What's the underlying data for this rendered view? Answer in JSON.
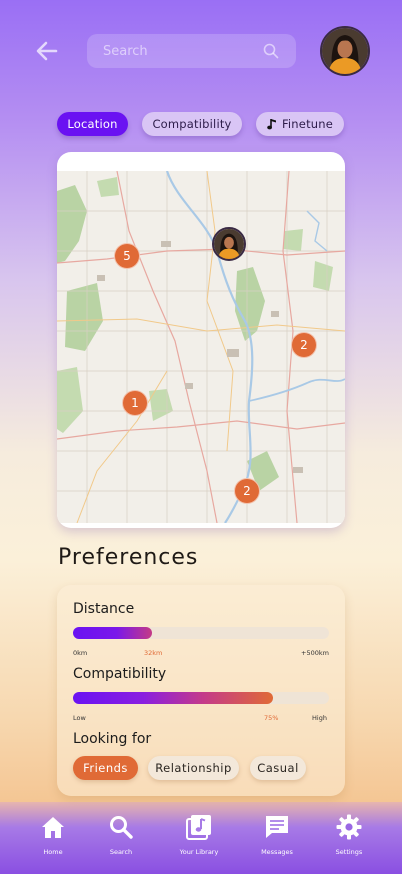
{
  "header": {
    "search_placeholder": "Search",
    "back_icon": "arrow-left-icon",
    "avatar_icon": "profile-avatar"
  },
  "tabs": [
    {
      "label": "Location",
      "active": true
    },
    {
      "label": "Compatibility",
      "active": false
    },
    {
      "label": "Finetune",
      "active": false,
      "icon": "music-note-icon"
    }
  ],
  "map": {
    "clusters": [
      {
        "count": "5"
      },
      {
        "count": "2"
      },
      {
        "count": "1"
      },
      {
        "count": "2"
      }
    ]
  },
  "preferences": {
    "title": "Preferences",
    "distance": {
      "label": "Distance",
      "value_fraction": 0.31,
      "min_label": "0km",
      "value_label": "32km",
      "max_label": "+500km"
    },
    "compatibility": {
      "label": "Compatibility",
      "value_fraction": 0.78,
      "min_label": "Low",
      "value_label": "75%",
      "max_label": "High"
    },
    "looking_for": {
      "label": "Looking for",
      "options": [
        {
          "label": "Friends",
          "selected": true
        },
        {
          "label": "Relationship",
          "selected": false
        },
        {
          "label": "Casual",
          "selected": false
        }
      ]
    }
  },
  "nav": [
    {
      "label": "Home",
      "icon": "home-icon"
    },
    {
      "label": "Search",
      "icon": "search-icon"
    },
    {
      "label": "Your Library",
      "icon": "library-icon"
    },
    {
      "label": "Messages",
      "icon": "messages-icon"
    },
    {
      "label": "Settings",
      "icon": "gear-icon"
    }
  ],
  "colors": {
    "accent_purple": "#6a12f2",
    "accent_orange": "#e06a36"
  }
}
